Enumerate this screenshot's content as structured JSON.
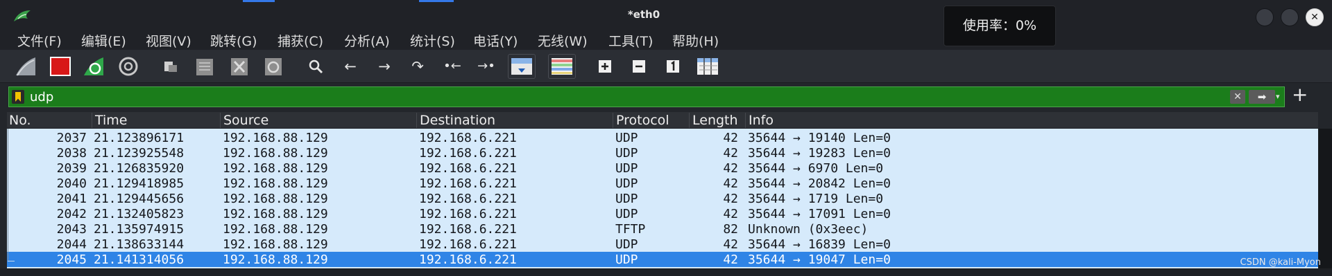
{
  "window": {
    "title": "*eth0",
    "close_glyph": "✕"
  },
  "tooltip": {
    "text": "使用率：0%"
  },
  "menu": [
    "文件(F)",
    "编辑(E)",
    "视图(V)",
    "跳转(G)",
    "捕获(C)",
    "分析(A)",
    "统计(S)",
    "电话(Y)",
    "无线(W)",
    "工具(T)",
    "帮助(H)"
  ],
  "toolbar": {
    "icons": [
      "shark-fin-start-icon",
      "stop-capture-icon",
      "restart-capture-icon",
      "capture-options-icon",
      "open-file-icon",
      "save-file-icon",
      "close-file-icon",
      "reload-file-icon",
      "find-packet-icon",
      "go-back-icon",
      "go-forward-icon",
      "go-to-packet-icon",
      "first-packet-icon",
      "last-packet-icon",
      "autoscroll-icon",
      "colorize-icon",
      "zoom-in-icon",
      "zoom-out-icon",
      "normal-size-icon",
      "resize-columns-icon"
    ],
    "glyphs": {
      "find": "🔍",
      "back": "←",
      "forward": "→",
      "goto": "↷",
      "first": "•←",
      "last": "→•",
      "zoom_in": "+",
      "zoom_out": "−",
      "normal": "1"
    }
  },
  "filter": {
    "value": "udp",
    "clear_glyph": "✕",
    "apply_glyph": "➡",
    "add_glyph": "+"
  },
  "columns": [
    "No.",
    "Time",
    "Source",
    "Destination",
    "Protocol",
    "Length",
    "Info"
  ],
  "packets": [
    {
      "no": "2037",
      "time": "21.123896171",
      "src": "192.168.88.129",
      "dst": "192.168.6.221",
      "proto": "UDP",
      "len": "42",
      "info": "35644 → 19140 Len=0"
    },
    {
      "no": "2038",
      "time": "21.123925548",
      "src": "192.168.88.129",
      "dst": "192.168.6.221",
      "proto": "UDP",
      "len": "42",
      "info": "35644 → 19283 Len=0"
    },
    {
      "no": "2039",
      "time": "21.126835920",
      "src": "192.168.88.129",
      "dst": "192.168.6.221",
      "proto": "UDP",
      "len": "42",
      "info": "35644 → 6970 Len=0"
    },
    {
      "no": "2040",
      "time": "21.129418985",
      "src": "192.168.88.129",
      "dst": "192.168.6.221",
      "proto": "UDP",
      "len": "42",
      "info": "35644 → 20842 Len=0"
    },
    {
      "no": "2041",
      "time": "21.129445656",
      "src": "192.168.88.129",
      "dst": "192.168.6.221",
      "proto": "UDP",
      "len": "42",
      "info": "35644 → 1719 Len=0"
    },
    {
      "no": "2042",
      "time": "21.132405823",
      "src": "192.168.88.129",
      "dst": "192.168.6.221",
      "proto": "UDP",
      "len": "42",
      "info": "35644 → 17091 Len=0"
    },
    {
      "no": "2043",
      "time": "21.135974915",
      "src": "192.168.88.129",
      "dst": "192.168.6.221",
      "proto": "TFTP",
      "len": "82",
      "info": "Unknown (0x3eec)"
    },
    {
      "no": "2044",
      "time": "21.138633144",
      "src": "192.168.88.129",
      "dst": "192.168.6.221",
      "proto": "UDP",
      "len": "42",
      "info": "35644 → 16839 Len=0"
    },
    {
      "no": "2045",
      "time": "21.141314056",
      "src": "192.168.88.129",
      "dst": "192.168.6.221",
      "proto": "UDP",
      "len": "42",
      "info": "35644 → 19047 Len=0",
      "selected": true
    }
  ],
  "watermark": "CSDN @kali-Myon",
  "colors": {
    "filter_valid": "#1b7d1b",
    "row_bg": "#d6eafb",
    "row_selected": "#2f84e6",
    "accent": "#3478e8"
  }
}
